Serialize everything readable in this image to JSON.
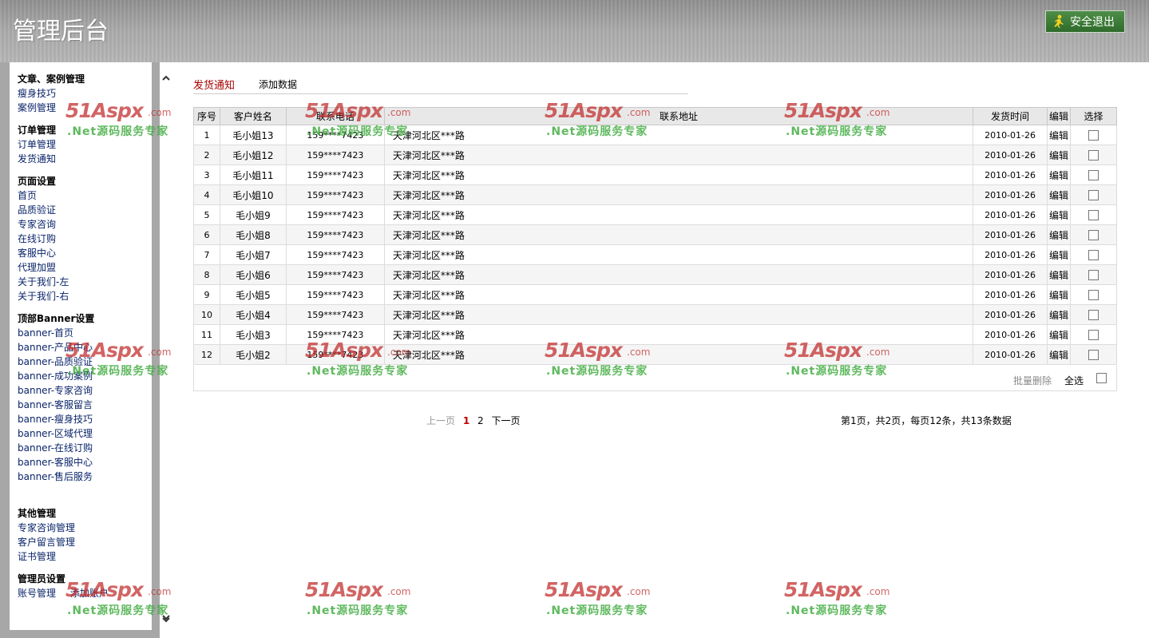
{
  "header": {
    "title": "管理后台",
    "logout_label": "安全退出"
  },
  "sidebar": {
    "groups": [
      {
        "title": "文章、案例管理",
        "items": [
          "瘦身技巧",
          "案例管理"
        ]
      },
      {
        "title": "订单管理",
        "items": [
          "订单管理",
          "发货通知"
        ]
      },
      {
        "title": "页面设置",
        "items": [
          "首页",
          "品质验证",
          "专家咨询",
          "在线订购",
          "客服中心",
          "代理加盟",
          "关于我们-左",
          "关于我们-右"
        ]
      },
      {
        "title": "顶部Banner设置",
        "items": [
          "banner-首页",
          "banner-产品中心",
          "banner-品质验证",
          "banner-成功案例",
          "banner-专家咨询",
          "banner-客服留言",
          "banner-瘦身技巧",
          "banner-区域代理",
          "banner-在线订购",
          "banner-客服中心",
          "banner-售后服务"
        ]
      },
      {
        "title": "其他管理",
        "items": [
          "专家咨询管理",
          "客户留言管理",
          "证书管理"
        ]
      },
      {
        "title": "管理员设置",
        "items": [
          "账号管理",
          "添加账户"
        ]
      }
    ]
  },
  "main": {
    "tabs": {
      "active": "发货通知",
      "add": "添加数据"
    },
    "table": {
      "headers": [
        "序号",
        "客户姓名",
        "联系电话",
        "联系地址",
        "发货时间",
        "编辑",
        "选择"
      ],
      "rows": [
        {
          "no": "1",
          "name": "毛小姐13",
          "phone": "159****7423",
          "address": "天津河北区***路",
          "date": "2010-01-26",
          "edit": "编辑"
        },
        {
          "no": "2",
          "name": "毛小姐12",
          "phone": "159****7423",
          "address": "天津河北区***路",
          "date": "2010-01-26",
          "edit": "编辑"
        },
        {
          "no": "3",
          "name": "毛小姐11",
          "phone": "159****7423",
          "address": "天津河北区***路",
          "date": "2010-01-26",
          "edit": "编辑"
        },
        {
          "no": "4",
          "name": "毛小姐10",
          "phone": "159****7423",
          "address": "天津河北区***路",
          "date": "2010-01-26",
          "edit": "编辑"
        },
        {
          "no": "5",
          "name": "毛小姐9",
          "phone": "159****7423",
          "address": "天津河北区***路",
          "date": "2010-01-26",
          "edit": "编辑"
        },
        {
          "no": "6",
          "name": "毛小姐8",
          "phone": "159****7423",
          "address": "天津河北区***路",
          "date": "2010-01-26",
          "edit": "编辑"
        },
        {
          "no": "7",
          "name": "毛小姐7",
          "phone": "159****7423",
          "address": "天津河北区***路",
          "date": "2010-01-26",
          "edit": "编辑"
        },
        {
          "no": "8",
          "name": "毛小姐6",
          "phone": "159****7423",
          "address": "天津河北区***路",
          "date": "2010-01-26",
          "edit": "编辑"
        },
        {
          "no": "9",
          "name": "毛小姐5",
          "phone": "159****7423",
          "address": "天津河北区***路",
          "date": "2010-01-26",
          "edit": "编辑"
        },
        {
          "no": "10",
          "name": "毛小姐4",
          "phone": "159****7423",
          "address": "天津河北区***路",
          "date": "2010-01-26",
          "edit": "编辑"
        },
        {
          "no": "11",
          "name": "毛小姐3",
          "phone": "159****7423",
          "address": "天津河北区***路",
          "date": "2010-01-26",
          "edit": "编辑"
        },
        {
          "no": "12",
          "name": "毛小姐2",
          "phone": "159****7423",
          "address": "天津河北区***路",
          "date": "2010-01-26",
          "edit": "编辑"
        }
      ]
    },
    "footer": {
      "batch_delete": "批量删除",
      "select_all": "全选"
    },
    "pager": {
      "prev": "上一页",
      "pages": [
        "1",
        "2"
      ],
      "current": "1",
      "next": "下一页",
      "info": "第1页，共2页，每页12条，共13条数据"
    }
  },
  "watermark": {
    "logo": "51Aspx",
    "domain": ".com",
    "slogan": ".Net源码服务专家"
  },
  "colors": {
    "active_tab": "#a50000",
    "logout_bg": "#3c7d38",
    "link": "#0a246a",
    "current_page": "#c00000"
  },
  "icons": [
    "person-run-icon",
    "chevron-up-icon",
    "chevron-down-icon",
    "checkbox-icon"
  ]
}
